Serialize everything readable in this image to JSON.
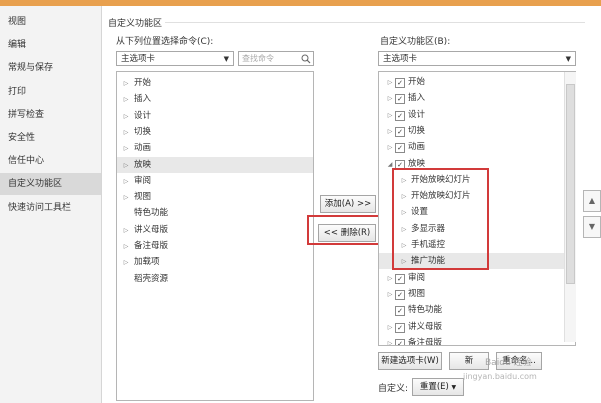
{
  "sidebar": {
    "items": [
      {
        "label": "视图"
      },
      {
        "label": "编辑"
      },
      {
        "label": "常规与保存"
      },
      {
        "label": "打印"
      },
      {
        "label": "拼写检查"
      },
      {
        "label": "安全性"
      },
      {
        "label": "信任中心"
      },
      {
        "label": "自定义功能区",
        "active": true
      },
      {
        "label": "快速访问工具栏"
      }
    ]
  },
  "group_title": "自定义功能区",
  "left": {
    "label": "从下列位置选择命令(C):",
    "combo_value": "主选项卡",
    "search_placeholder": "查找命令",
    "rows": [
      {
        "label": "开始",
        "arrow": true
      },
      {
        "label": "插入",
        "arrow": true
      },
      {
        "label": "设计",
        "arrow": true
      },
      {
        "label": "切换",
        "arrow": true
      },
      {
        "label": "动画",
        "arrow": true
      },
      {
        "label": "放映",
        "arrow": true,
        "selected": true
      },
      {
        "label": "审阅",
        "arrow": true
      },
      {
        "label": "视图",
        "arrow": true
      },
      {
        "label": "特色功能",
        "arrow": false
      },
      {
        "label": "讲义母版",
        "arrow": true
      },
      {
        "label": "备注母版",
        "arrow": true
      },
      {
        "label": "加载项",
        "arrow": true
      },
      {
        "label": "稻壳资源",
        "arrow": false
      }
    ]
  },
  "middle": {
    "add_label": "添加(A) >>",
    "remove_label": "<< 删除(R)"
  },
  "right": {
    "label": "自定义功能区(B):",
    "combo_value": "主选项卡",
    "rows": [
      {
        "label": "开始",
        "indent": 0,
        "arrow": "▸",
        "check": true
      },
      {
        "label": "插入",
        "indent": 0,
        "arrow": "▸",
        "check": true
      },
      {
        "label": "设计",
        "indent": 0,
        "arrow": "▸",
        "check": true
      },
      {
        "label": "切换",
        "indent": 0,
        "arrow": "▸",
        "check": true
      },
      {
        "label": "动画",
        "indent": 0,
        "arrow": "▸",
        "check": true
      },
      {
        "label": "放映",
        "indent": 0,
        "arrow": "◢",
        "check": true
      },
      {
        "label": "开始放映幻灯片",
        "indent": 1,
        "arrow": "▸",
        "check": null
      },
      {
        "label": "开始放映幻灯片",
        "indent": 1,
        "arrow": "▸",
        "check": null
      },
      {
        "label": "设置",
        "indent": 1,
        "arrow": "▸",
        "check": null
      },
      {
        "label": "多显示器",
        "indent": 1,
        "arrow": "▸",
        "check": null
      },
      {
        "label": "手机遥控",
        "indent": 1,
        "arrow": "▸",
        "check": null
      },
      {
        "label": "推广功能",
        "indent": 1,
        "arrow": "▸",
        "check": null,
        "selected": true
      },
      {
        "label": "审阅",
        "indent": 0,
        "arrow": "▸",
        "check": true
      },
      {
        "label": "视图",
        "indent": 0,
        "arrow": "▸",
        "check": true
      },
      {
        "label": "特色功能",
        "indent": 0,
        "arrow": "",
        "check": true
      },
      {
        "label": "讲义母版",
        "indent": 0,
        "arrow": "▸",
        "check": true
      },
      {
        "label": "备注母版",
        "indent": 0,
        "arrow": "▸",
        "check": true
      }
    ]
  },
  "bottom": {
    "new_tab_label": "新建选项卡(W)",
    "new_group_label": "新",
    "rename_label": "重命名...",
    "custom_label": "自定义:",
    "reset_label": "重置(E)"
  },
  "watermark": {
    "line1": "Baidu 经验",
    "line2": "jingyan.baidu.com"
  },
  "colors": {
    "highlight": "#d23a3a",
    "titlebar": "#e8a04e",
    "sidebar_active": "#d9d9d9"
  }
}
